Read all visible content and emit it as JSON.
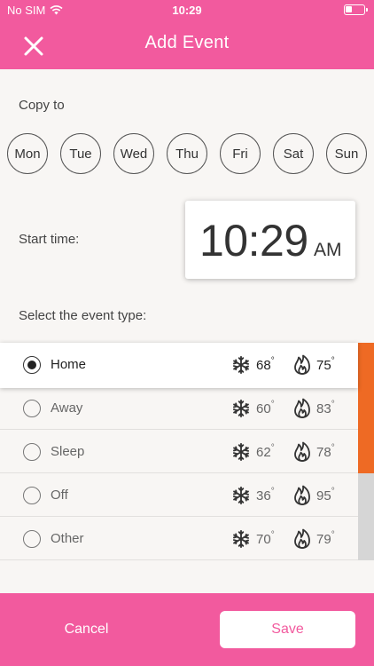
{
  "status_bar": {
    "carrier": "No SIM",
    "time": "10:29",
    "wifi_icon": "wifi-icon",
    "battery_icon": "battery-icon"
  },
  "header": {
    "title": "Add Event",
    "close_icon": "close-icon",
    "background": "#f25a9e"
  },
  "copy_to": {
    "label": "Copy to",
    "days": [
      "Mon",
      "Tue",
      "Wed",
      "Thu",
      "Fri",
      "Sat",
      "Sun"
    ]
  },
  "start_time": {
    "label": "Start time:",
    "time": "10:29",
    "ampm": "AM"
  },
  "event_type": {
    "label": "Select the event type:",
    "cool_icon": "snowflake-icon",
    "heat_icon": "flame-icon",
    "degree_symbol": "°",
    "events": [
      {
        "name": "Home",
        "cool": "68",
        "heat": "75",
        "selected": true,
        "color": "#ee6a24"
      },
      {
        "name": "Away",
        "cool": "60",
        "heat": "83",
        "selected": false,
        "color": "#ee6a24"
      },
      {
        "name": "Sleep",
        "cool": "62",
        "heat": "78",
        "selected": false,
        "color": "#ee6a24"
      },
      {
        "name": "Off",
        "cool": "36",
        "heat": "95",
        "selected": false,
        "color": "#d6d6d6"
      },
      {
        "name": "Other",
        "cool": "70",
        "heat": "79",
        "selected": false,
        "color": "#d6d6d6"
      }
    ]
  },
  "footer": {
    "cancel_label": "Cancel",
    "save_label": "Save",
    "background": "#f25a9e"
  }
}
